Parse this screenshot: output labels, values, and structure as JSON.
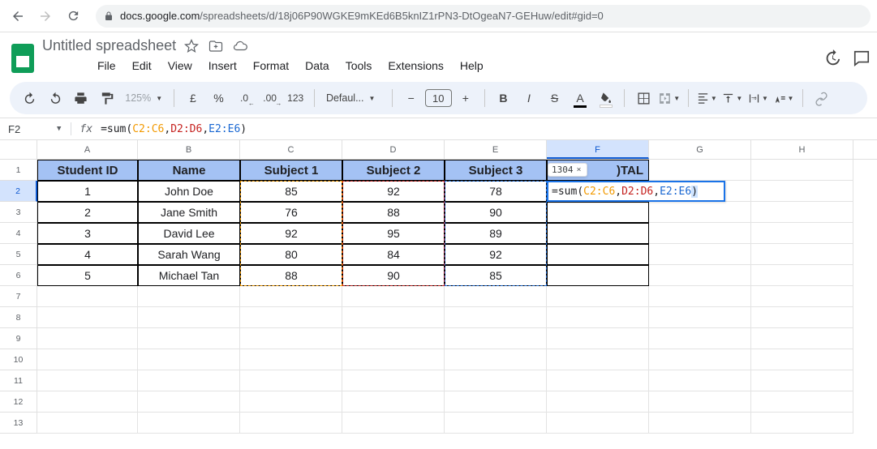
{
  "browser": {
    "url_host": "docs.google.com",
    "url_path": "/spreadsheets/d/18j06P90WGKE9mKEd6B5knIZ1rPN3-DtOgeaN7-GEHuw/edit#gid=0"
  },
  "doc": {
    "title": "Untitled spreadsheet"
  },
  "menu": {
    "file": "File",
    "edit": "Edit",
    "view": "View",
    "insert": "Insert",
    "format": "Format",
    "data": "Data",
    "tools": "Tools",
    "extensions": "Extensions",
    "help": "Help"
  },
  "toolbar": {
    "zoom": "125%",
    "currency": "£",
    "percent": "%",
    "dec_dec": ".0",
    "inc_dec": ".00",
    "numfmt": "123",
    "font": "Defaul...",
    "fontsize": "10"
  },
  "formula_bar": {
    "cell_ref": "F2",
    "raw_text": "=sum(C2:C6,D2:D6,E2:E6)",
    "fn": "=sum",
    "open": "(",
    "close": ")",
    "r1": "C2:C6",
    "r2": "D2:D6",
    "r3": "E2:E6",
    "comma": ","
  },
  "result_hint": {
    "value": "1304"
  },
  "columns": [
    "A",
    "B",
    "C",
    "D",
    "E",
    "F",
    "G",
    "H"
  ],
  "row_numbers": [
    "1",
    "2",
    "3",
    "4",
    "5",
    "6",
    "7",
    "8",
    "9",
    "10",
    "11",
    "12",
    "13"
  ],
  "headers": {
    "a": "Student ID",
    "b": "Name",
    "c": "Subject 1",
    "d": "Subject 2",
    "e": "Subject 3",
    "f": ")TAL"
  },
  "data": [
    {
      "id": "1",
      "name": "John Doe",
      "s1": "85",
      "s2": "92",
      "s3": "78"
    },
    {
      "id": "2",
      "name": "Jane Smith",
      "s1": "76",
      "s2": "88",
      "s3": "90"
    },
    {
      "id": "3",
      "name": "David Lee",
      "s1": "92",
      "s2": "95",
      "s3": "89"
    },
    {
      "id": "4",
      "name": "Sarah Wang",
      "s1": "80",
      "s2": "84",
      "s3": "92"
    },
    {
      "id": "5",
      "name": "Michael Tan",
      "s1": "88",
      "s2": "90",
      "s3": "85"
    }
  ],
  "chart_data": {
    "type": "table",
    "columns": [
      "Student ID",
      "Name",
      "Subject 1",
      "Subject 2",
      "Subject 3"
    ],
    "rows": [
      [
        1,
        "John Doe",
        85,
        92,
        78
      ],
      [
        2,
        "Jane Smith",
        76,
        88,
        90
      ],
      [
        3,
        "David Lee",
        92,
        95,
        89
      ],
      [
        4,
        "Sarah Wang",
        80,
        84,
        92
      ],
      [
        5,
        "Michael Tan",
        88,
        90,
        85
      ]
    ]
  }
}
